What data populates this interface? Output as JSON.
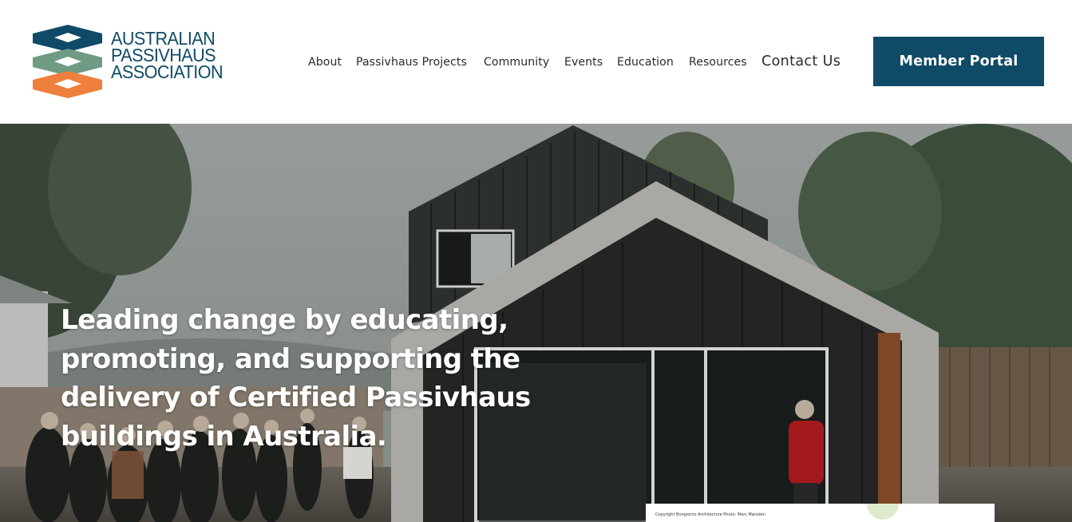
{
  "logo": {
    "line1": "AUSTRALIAN",
    "line2": "PASSIVHAUS",
    "line3": "ASSOCIATION",
    "colors": {
      "top": "#0f4a66",
      "middle": "#6f9a84",
      "bottom": "#ef7f3c"
    }
  },
  "nav": {
    "items": [
      "About",
      "Passivhaus Projects",
      "Community",
      "Events",
      "Education",
      "Resources",
      "Contact Us"
    ]
  },
  "portal": {
    "label": "Member Portal",
    "color": "#0f4a66"
  },
  "hero": {
    "headline": "Leading change by educating, promoting, and supporting the delivery of Certified Passivhaus buildings in Australia.",
    "caption": "Copyright Bongiorno Architecture Photo: Marc Marsden"
  }
}
